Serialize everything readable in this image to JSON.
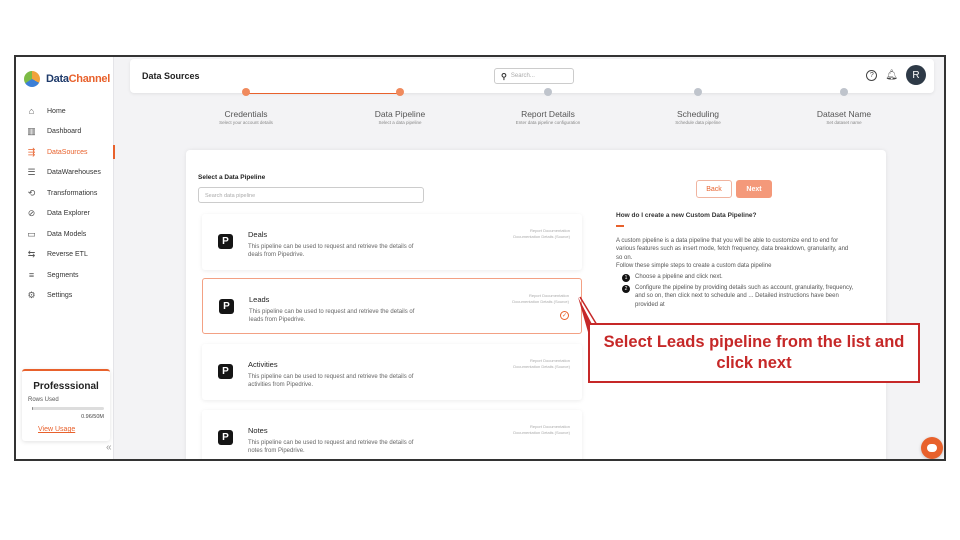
{
  "brand": {
    "name_part1": "Data",
    "name_part2": "Channel"
  },
  "header": {
    "title": "Data Sources",
    "search_placeholder": "Search...",
    "avatar_initial": "R",
    "help_glyph": "?",
    "bell_glyph": "♫"
  },
  "sidebar": {
    "items": [
      {
        "label": "Home",
        "icon": "home-icon",
        "glyph": "⌂"
      },
      {
        "label": "Dashboard",
        "icon": "dashboard-icon",
        "glyph": "▥"
      },
      {
        "label": "DataSources",
        "icon": "datasources-icon",
        "glyph": "⇶"
      },
      {
        "label": "DataWarehouses",
        "icon": "database-icon",
        "glyph": "☰"
      },
      {
        "label": "Transformations",
        "icon": "transform-icon",
        "glyph": "⟲"
      },
      {
        "label": "Data Explorer",
        "icon": "explorer-icon",
        "glyph": "⊘"
      },
      {
        "label": "Data Models",
        "icon": "models-icon",
        "glyph": "▭"
      },
      {
        "label": "Reverse ETL",
        "icon": "reverse-etl-icon",
        "glyph": "⇆"
      },
      {
        "label": "Segments",
        "icon": "segments-icon",
        "glyph": "≡"
      },
      {
        "label": "Settings",
        "icon": "settings-icon",
        "glyph": "⚙"
      }
    ],
    "active_index": 2,
    "plan": {
      "name": "Professsional",
      "rows_label": "Rows Used",
      "usage": "0.96/50M",
      "usage_fraction": 0.02,
      "link": "View Usage"
    },
    "collapse_glyph": "«"
  },
  "stepper": {
    "steps": [
      {
        "label": "Credentials",
        "sub": "Select your account details",
        "status": "done"
      },
      {
        "label": "Data Pipeline",
        "sub": "Select a data pipeline",
        "status": "active"
      },
      {
        "label": "Report Details",
        "sub": "Enter data pipeline configuration",
        "status": "pending"
      },
      {
        "label": "Scheduling",
        "sub": "Schedule data pipeline",
        "status": "pending"
      },
      {
        "label": "Dataset Name",
        "sub": "Set dataset name",
        "status": "pending"
      }
    ]
  },
  "main": {
    "select_title": "Select a Data Pipeline",
    "filter_placeholder": "Search data pipeline",
    "back_label": "Back",
    "next_label": "Next",
    "pipelines": [
      {
        "name": "Deals",
        "desc": "This pipeline can be used to request and retrieve the details of deals from Pipedrive.",
        "doc1": "Report Documentation",
        "doc2": "Documentation Details (Source)",
        "selected": false
      },
      {
        "name": "Leads",
        "desc": "This pipeline can be used to request and retrieve the details of leads from Pipedrive.",
        "doc1": "Report Documentation",
        "doc2": "Documentation Details (Source)",
        "selected": true
      },
      {
        "name": "Activities",
        "desc": "This pipeline can be used to request and retrieve the details of activities from Pipedrive.",
        "doc1": "Report Documentation",
        "doc2": "Documentation Details (Source)",
        "selected": false
      },
      {
        "name": "Notes",
        "desc": "This pipeline can be used to request and retrieve the details of notes from Pipedrive.",
        "doc1": "Report Documentation",
        "doc2": "Documentation Details (Source)",
        "selected": false
      }
    ],
    "logo_letter": "P",
    "help": {
      "title": "How do I create a new Custom Data Pipeline?",
      "body": "A custom pipeline is a data pipeline that you will be able to customize end to end for various features such as insert mode, fetch frequency, data breakdown, granularity, and so on.",
      "intro": "Follow these simple steps to create a custom data pipeline",
      "steps": [
        {
          "n": "1",
          "text": "Choose a pipeline and click next."
        },
        {
          "n": "2",
          "text": "Configure the pipeline by providing details such as account, granularity, frequency, and so on, then click next to schedule and ... Detailed instructions have been provided at"
        }
      ]
    }
  },
  "callout": {
    "text": "Select Leads pipeline from the list and click next"
  },
  "colors": {
    "accent": "#e8612c",
    "callout": "#c62828"
  }
}
